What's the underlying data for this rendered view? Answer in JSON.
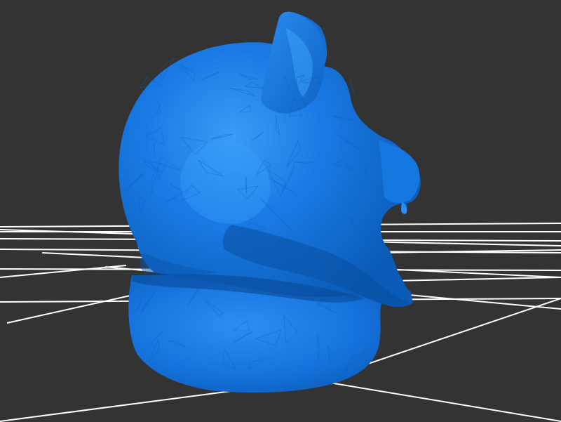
{
  "scene": {
    "background_color": "#333333",
    "grid_color": "#ffffff",
    "grid_visible": true,
    "model": {
      "subject": "bear-bust",
      "shading": "flat-faceted",
      "base_color": "#0d6fd8",
      "highlight_color": "#2f8ff0",
      "shadow_color": "#0a55ad"
    }
  }
}
